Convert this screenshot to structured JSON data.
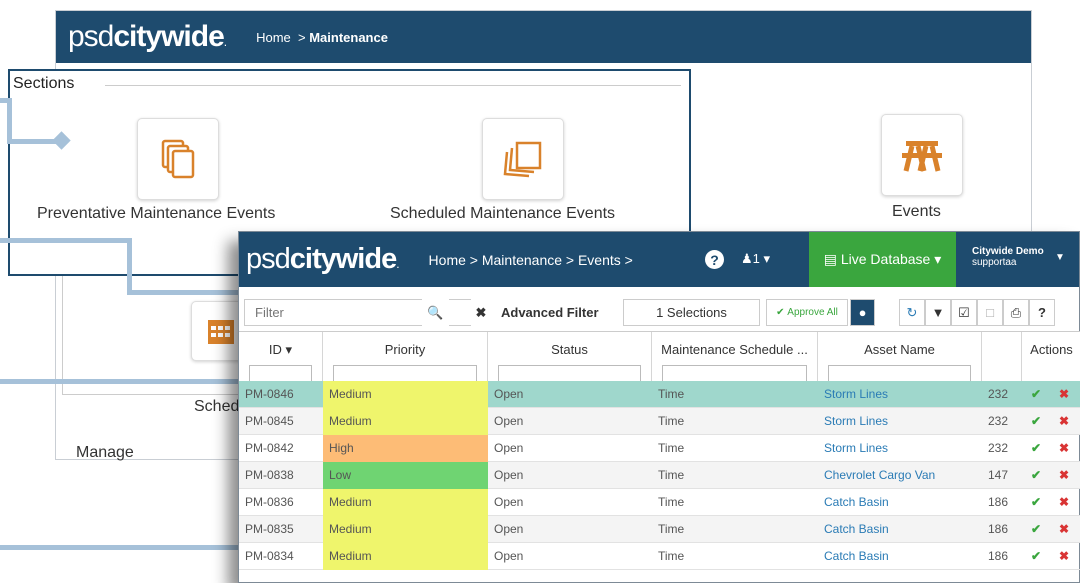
{
  "back_window": {
    "logo_light": "psd",
    "logo_bold": "citywide",
    "logo_dot": ".",
    "breadcrumb_home": "Home",
    "breadcrumb_current": "Maintenance",
    "sections_title": "Sections",
    "tile_preventative": "Preventative Maintenance Events",
    "tile_scheduled": "Scheduled Maintenance Events",
    "tile_events": "Events",
    "partial_sched": "Sched",
    "partial_manage": "Manage"
  },
  "front_window": {
    "logo_light": "psd",
    "logo_bold": "citywide",
    "logo_dot": ".",
    "breadcrumb": "Home  >  Maintenance  >  Events  >",
    "help": "?",
    "users": "1 ▾",
    "live_database": "Live Database ▾",
    "account_name": "Citywide Demo",
    "account_user": "supportaa",
    "filter_placeholder": "Filter",
    "advanced_filter": "Advanced Filter",
    "selections": "1 Selections",
    "approve_all": "Approve All",
    "columns": [
      "ID ▾",
      "Priority",
      "Status",
      "Maintenance Schedule ...",
      "Asset Name",
      "",
      "Actions"
    ],
    "rows": [
      {
        "id": "PM-0846",
        "priority": "Medium",
        "status": "Open",
        "schedule": "Time",
        "asset": "Storm Lines",
        "num": "232"
      },
      {
        "id": "PM-0845",
        "priority": "Medium",
        "status": "Open",
        "schedule": "Time",
        "asset": "Storm Lines",
        "num": "232"
      },
      {
        "id": "PM-0842",
        "priority": "High",
        "status": "Open",
        "schedule": "Time",
        "asset": "Storm Lines",
        "num": "232"
      },
      {
        "id": "PM-0838",
        "priority": "Low",
        "status": "Open",
        "schedule": "Time",
        "asset": "Chevrolet Cargo Van",
        "num": "147"
      },
      {
        "id": "PM-0836",
        "priority": "Medium",
        "status": "Open",
        "schedule": "Time",
        "asset": "Catch Basin",
        "num": "186"
      },
      {
        "id": "PM-0835",
        "priority": "Medium",
        "status": "Open",
        "schedule": "Time",
        "asset": "Catch Basin",
        "num": "186"
      },
      {
        "id": "PM-0834",
        "priority": "Medium",
        "status": "Open",
        "schedule": "Time",
        "asset": "Catch Basin",
        "num": "186"
      }
    ],
    "selected_row": 0
  },
  "colors": {
    "header": "#1e4b6e",
    "live_db": "#3aa63e",
    "priority_medium": "#eff56c",
    "priority_high": "#fdbc76",
    "priority_low": "#6fd472",
    "selected_row": "#9fd7cc",
    "connector": "#a6c1d9",
    "tile_icon": "#d9822b"
  },
  "icons": [
    "copy-icon",
    "stack-icon",
    "picnic-table-icon",
    "calendar-icon",
    "search-icon",
    "clear-icon",
    "globe-icon",
    "refresh-icon",
    "filter-icon",
    "check-icon",
    "document-icon",
    "print-icon",
    "help-icon"
  ]
}
